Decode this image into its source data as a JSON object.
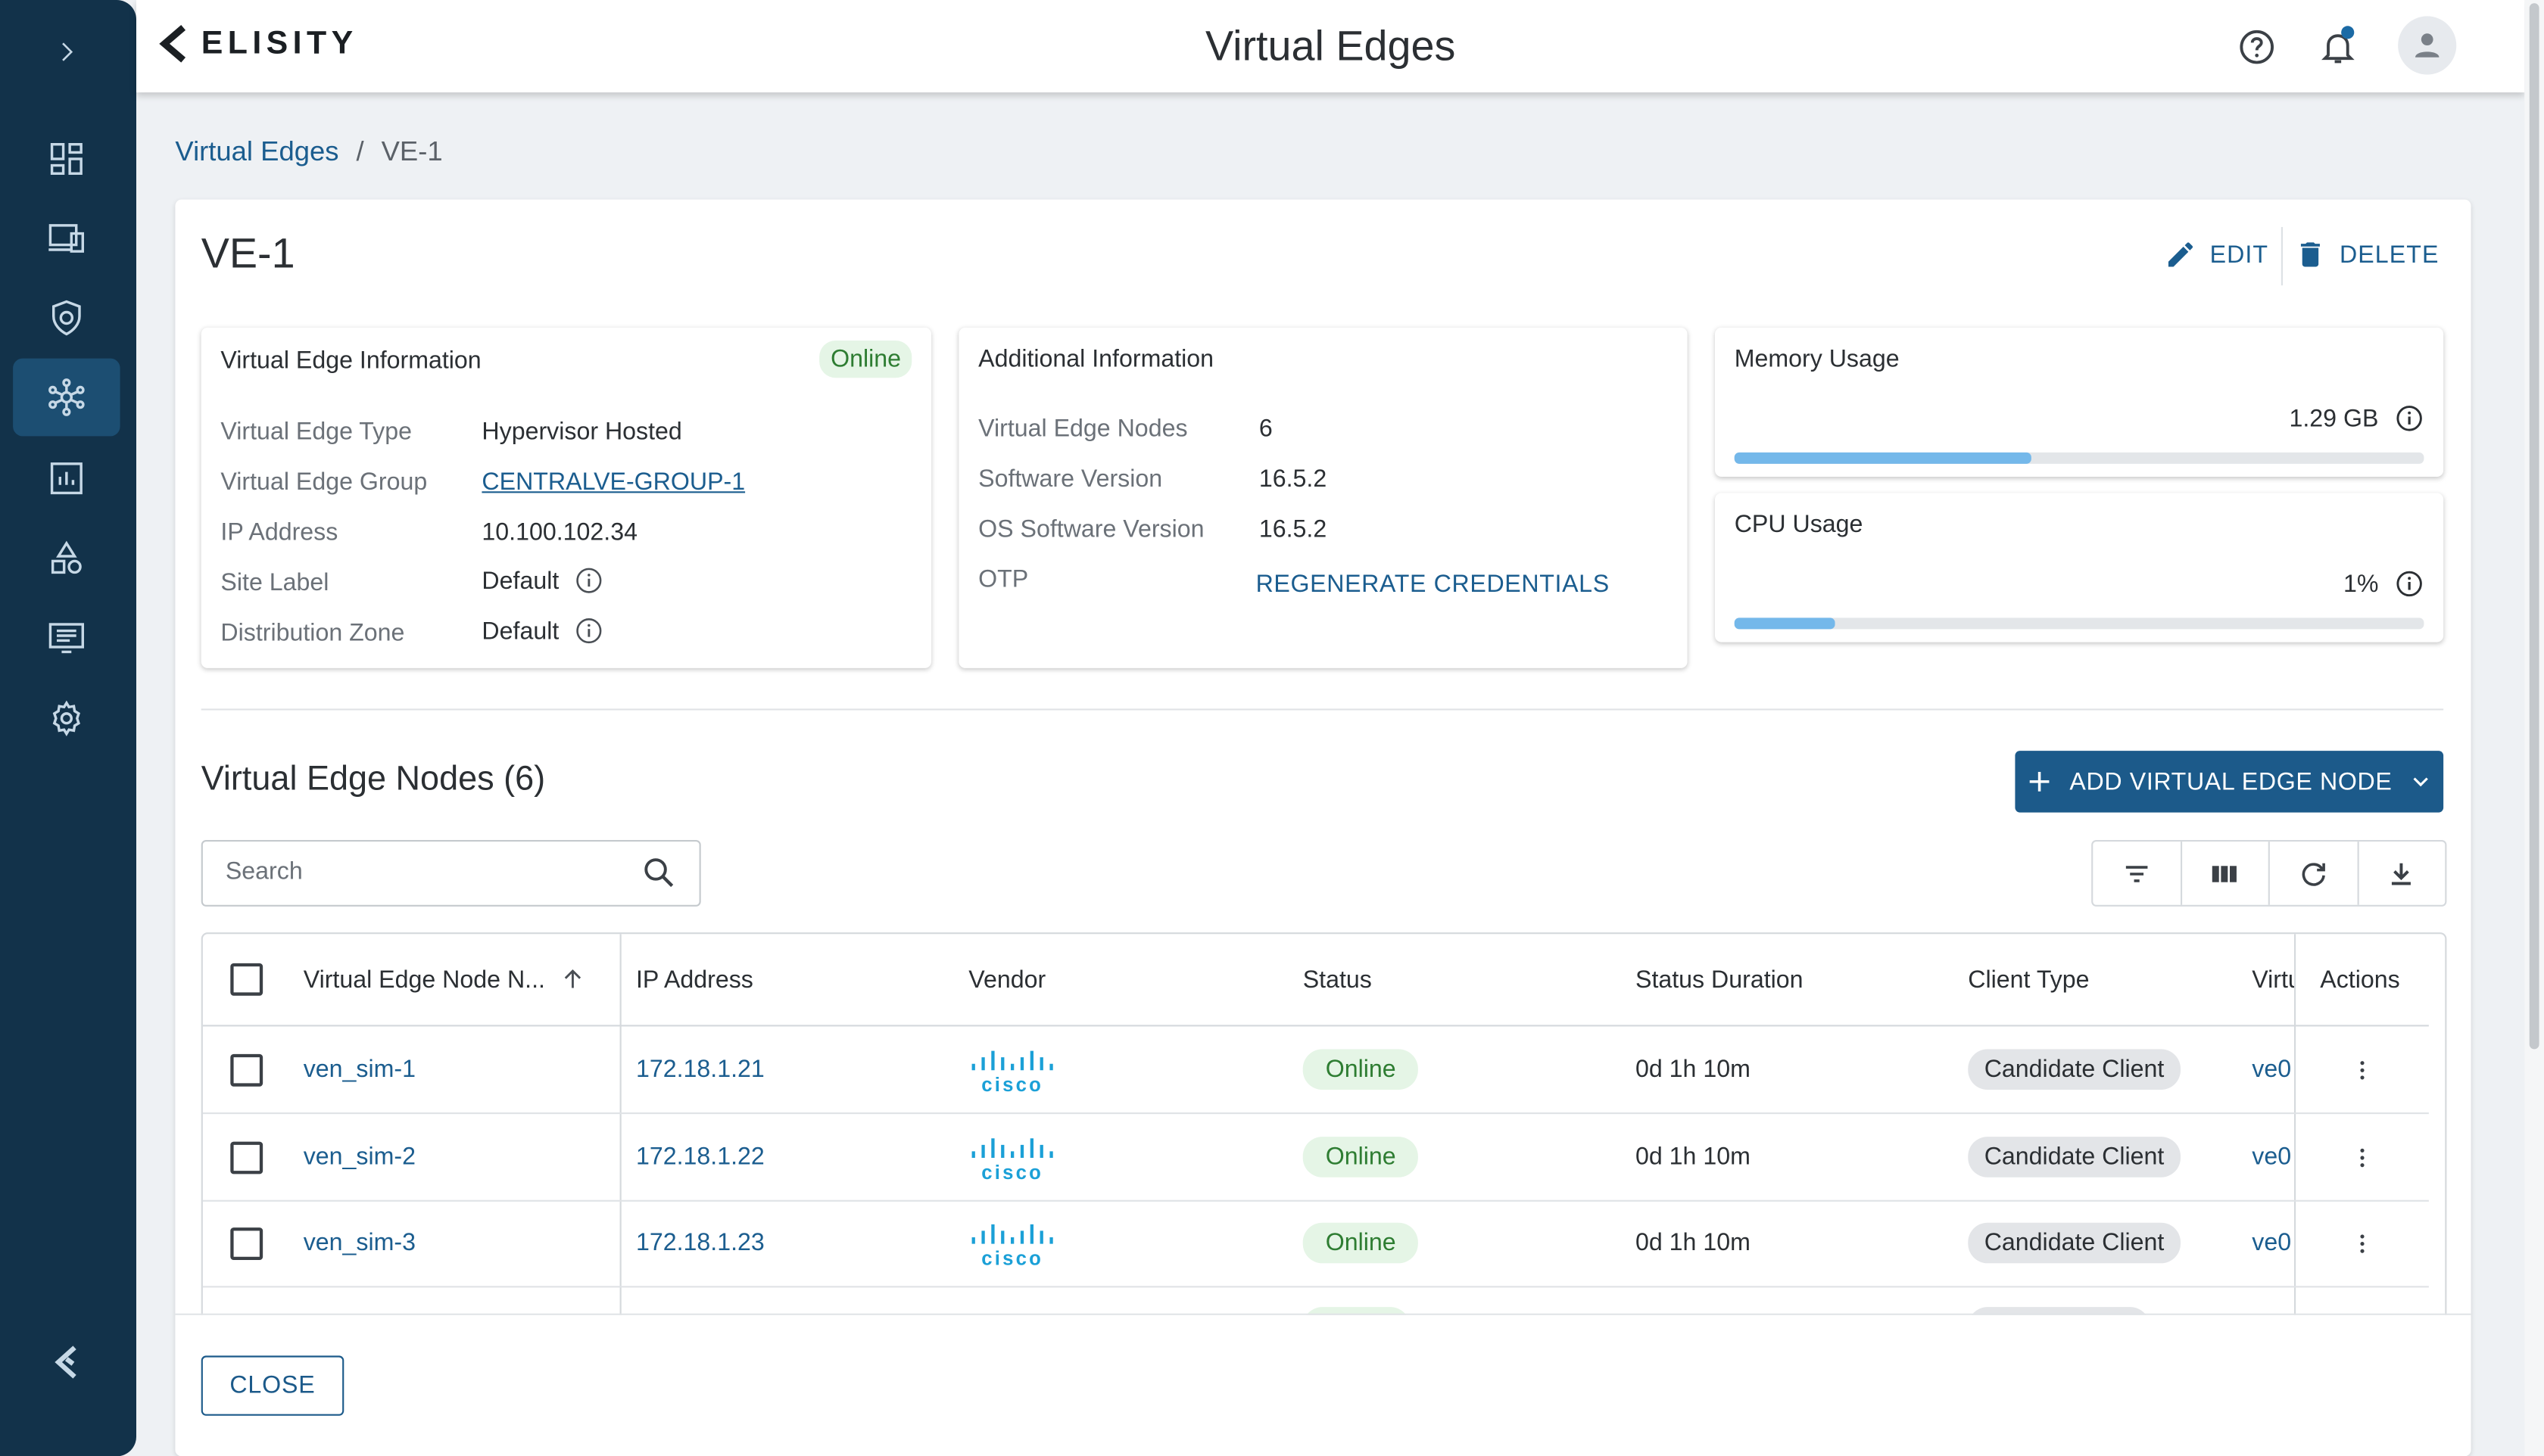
{
  "header": {
    "logo_text": "ELISITY",
    "title": "Virtual Edges"
  },
  "sidebar": {
    "items": [
      {
        "icon": "dashboard-icon",
        "active": false
      },
      {
        "icon": "devices-icon",
        "active": false
      },
      {
        "icon": "policy-shield-icon",
        "active": false
      },
      {
        "icon": "topology-icon",
        "active": true
      },
      {
        "icon": "analytics-icon",
        "active": false
      },
      {
        "icon": "shapes-icon",
        "active": false
      },
      {
        "icon": "logs-icon",
        "active": false
      },
      {
        "icon": "settings-gear-icon",
        "active": false
      }
    ]
  },
  "breadcrumb": {
    "parent": "Virtual Edges",
    "separator": "/",
    "current": "VE-1"
  },
  "detail": {
    "title": "VE-1",
    "edit_label": "EDIT",
    "delete_label": "DELETE"
  },
  "ve_info": {
    "title": "Virtual Edge Information",
    "status": "Online",
    "rows": {
      "type_label": "Virtual Edge Type",
      "type_value": "Hypervisor Hosted",
      "group_label": "Virtual Edge Group",
      "group_value": "CENTRALVE-GROUP-1",
      "ip_label": "IP Address",
      "ip_value": "10.100.102.34",
      "site_label": "Site Label",
      "site_value": "Default",
      "zone_label": "Distribution Zone",
      "zone_value": "Default"
    }
  },
  "additional_info": {
    "title": "Additional Information",
    "nodes_label": "Virtual Edge Nodes",
    "nodes_value": "6",
    "sw_label": "Software Version",
    "sw_value": "16.5.2",
    "os_label": "OS Software Version",
    "os_value": "16.5.2",
    "otp_label": "OTP",
    "otp_action": "REGENERATE CREDENTIALS"
  },
  "memory": {
    "title": "Memory Usage",
    "value": "1.29 GB",
    "fill_fraction": 0.43
  },
  "cpu": {
    "title": "CPU Usage",
    "value": "1%",
    "fill_fraction": 0.145
  },
  "nodes": {
    "title": "Virtual Edge Nodes (6)",
    "add_label": "ADD VIRTUAL EDGE NODE",
    "search_placeholder": "Search",
    "columns": [
      "Virtual Edge Node N...",
      "IP Address",
      "Vendor",
      "Status",
      "Status Duration",
      "Client Type",
      "Virtu",
      "Actions"
    ],
    "rows": [
      {
        "name": "ven_sim-1",
        "ip": "172.18.1.21",
        "vendor": "cisco",
        "status": "Online",
        "duration": "0d 1h 10m",
        "client_type": "Candidate Client",
        "virt": "ve0"
      },
      {
        "name": "ven_sim-2",
        "ip": "172.18.1.22",
        "vendor": "cisco",
        "status": "Online",
        "duration": "0d 1h 10m",
        "client_type": "Candidate Client",
        "virt": "ve0"
      },
      {
        "name": "ven_sim-3",
        "ip": "172.18.1.23",
        "vendor": "cisco",
        "status": "Online",
        "duration": "0d 1h 10m",
        "client_type": "Candidate Client",
        "virt": "ve0"
      }
    ]
  },
  "footer": {
    "close_label": "CLOSE"
  },
  "colors": {
    "sidebar": "#12324a",
    "primary": "#1c5a8a",
    "link": "#1b5d8f",
    "online_bg": "#e5f5e6",
    "online_text": "#2e7d32",
    "bar_fill": "#74b8ea"
  }
}
